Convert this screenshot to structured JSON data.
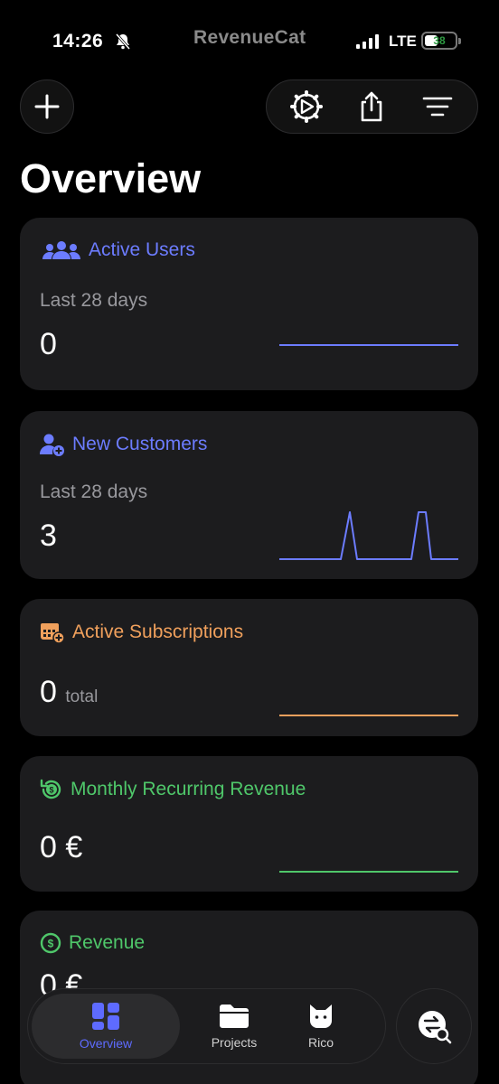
{
  "status": {
    "time": "14:26",
    "carrier_logo": "RevenueCat",
    "network": "LTE",
    "battery": "38"
  },
  "toolbar": {
    "add_icon": "plus-icon",
    "settings_icon": "gear-icon",
    "share_icon": "share-icon",
    "filter_icon": "filter-icon"
  },
  "page_title": "Overview",
  "cards": [
    {
      "title": "Active Users",
      "subtitle": "Last 28 days",
      "value": "0",
      "color": "#6c7cff"
    },
    {
      "title": "New Customers",
      "subtitle": "Last 28 days",
      "value": "3",
      "color": "#6c7cff"
    },
    {
      "title": "Active Subscriptions",
      "value": "0",
      "unit": "total",
      "color": "#f0a05c"
    },
    {
      "title": "Monthly Recurring Revenue",
      "value": "0 €",
      "color": "#4fc76a"
    },
    {
      "title": "Revenue",
      "value": "0 €",
      "color": "#4fc76a"
    }
  ],
  "tabs": [
    {
      "label": "Overview",
      "icon": "dashboard-icon",
      "active": true
    },
    {
      "label": "Projects",
      "icon": "folder-icon"
    },
    {
      "label": "Rico",
      "icon": "cat-icon"
    }
  ],
  "fab_icon": "exchange-search-icon"
}
